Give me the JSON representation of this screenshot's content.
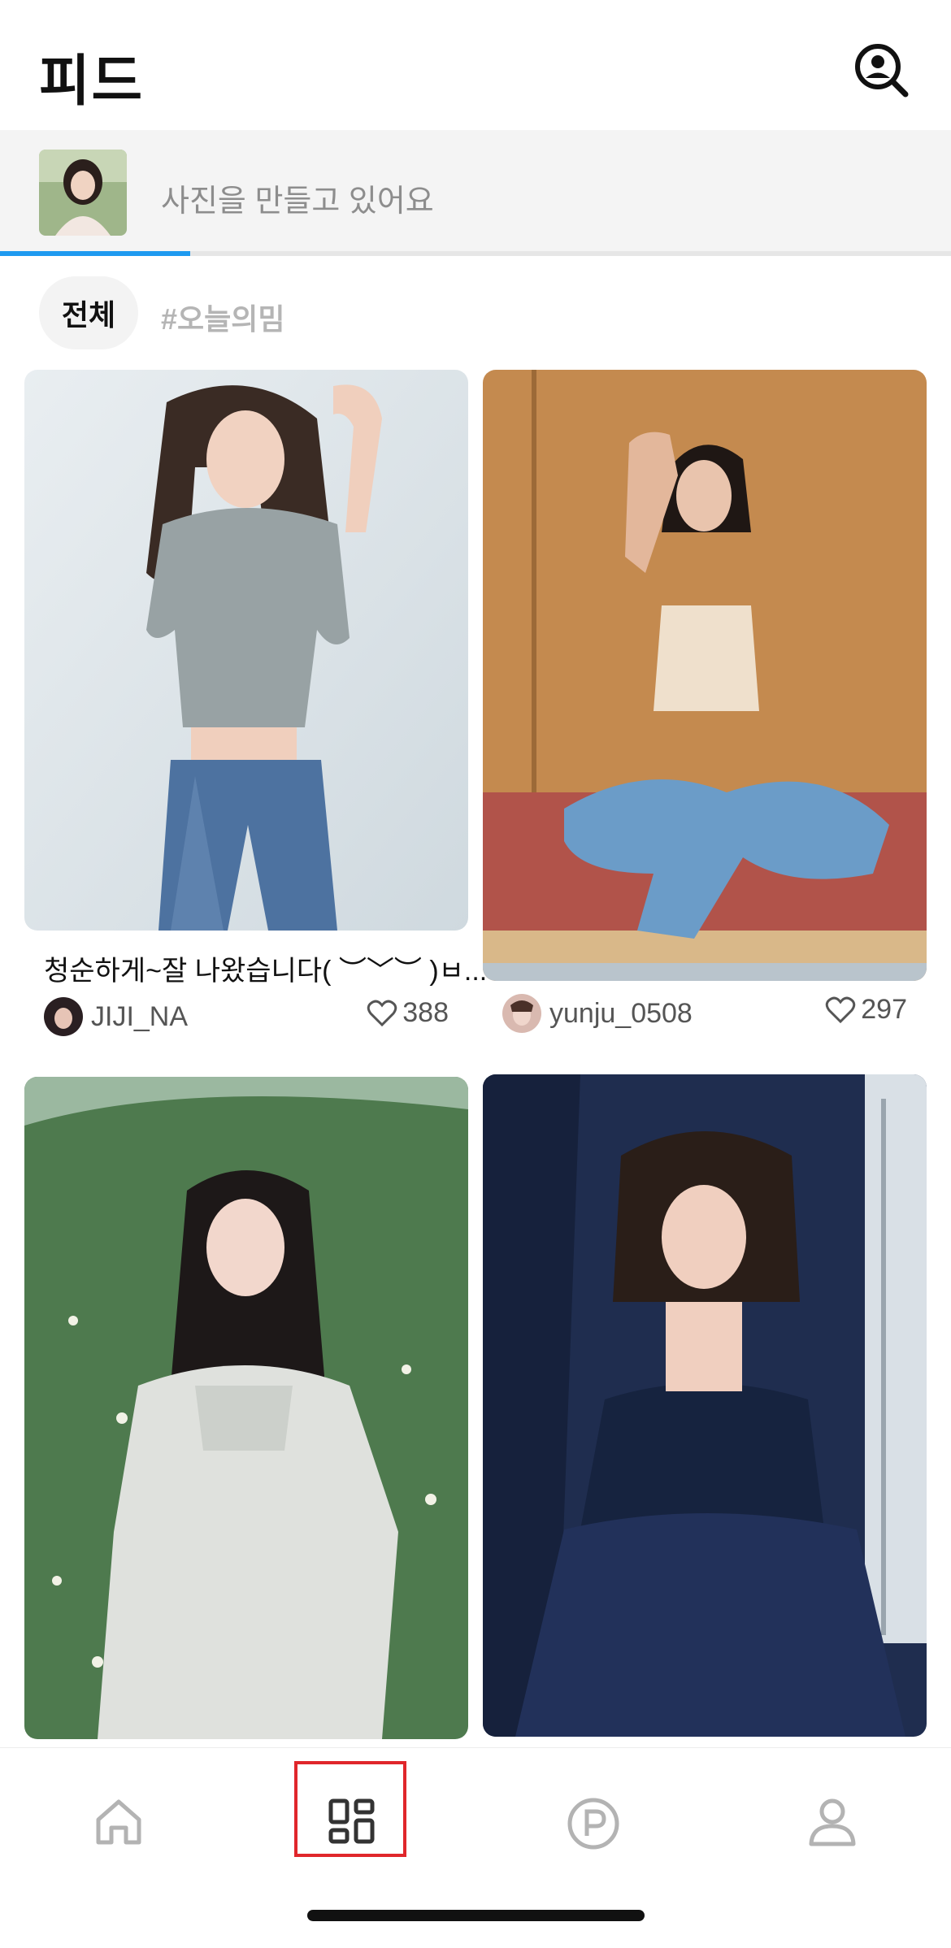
{
  "header": {
    "title": "피드",
    "profile_search_icon": "person-search-icon"
  },
  "progress": {
    "text": "사진을 만들고 있어요",
    "fraction": 0.2
  },
  "filters": {
    "all_label": "전체",
    "tag_label": "#오늘의밈"
  },
  "feed": [
    {
      "caption": "청순하게~잘 나왔습니다( ︶﹀︶ )ㅂ...",
      "author": "JIJI_NA",
      "likes": "388"
    },
    {
      "caption": "",
      "author": "yunju_0508",
      "likes": "297"
    },
    {
      "caption": "",
      "author": "",
      "likes": ""
    },
    {
      "caption": "",
      "author": "",
      "likes": ""
    }
  ],
  "tabbar": {
    "items": [
      {
        "icon": "home-icon"
      },
      {
        "icon": "feed-grid-icon",
        "selected": true
      },
      {
        "icon": "point-icon"
      },
      {
        "icon": "profile-icon"
      }
    ]
  },
  "colors": {
    "accent": "#1e9af0",
    "selection_box": "#e0262b",
    "text_muted": "#8d8d8d"
  }
}
